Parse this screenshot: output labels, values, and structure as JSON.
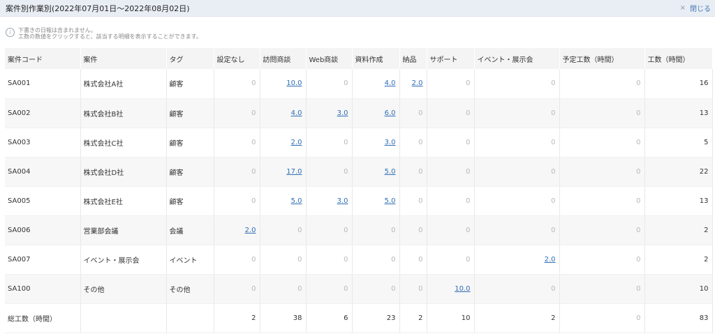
{
  "header": {
    "title": "案件別作業別(2022年07月01日〜2022年08月02日)",
    "close_x": "×",
    "close_label": "閉じる"
  },
  "notice": {
    "line1": "下書きの日報は含まれません。",
    "line2": "工数の数値をクリックすると、該当する明細を表示することができます。"
  },
  "table": {
    "headers": [
      "案件コード",
      "案件",
      "タグ",
      "設定なし",
      "訪問商談",
      "Web商談",
      "資料作成",
      "納品",
      "サポート",
      "イベント・展示会",
      "予定工数（時間）",
      "工数（時間）"
    ],
    "rows": [
      {
        "code": "SA001",
        "name": "株式会社A社",
        "tag": "顧客",
        "values": [
          "0",
          "10.0",
          "0",
          "4.0",
          "2.0",
          "0",
          "0",
          "0",
          "16"
        ]
      },
      {
        "code": "SA002",
        "name": "株式会社B社",
        "tag": "顧客",
        "values": [
          "0",
          "4.0",
          "3.0",
          "6.0",
          "0",
          "0",
          "0",
          "0",
          "13"
        ]
      },
      {
        "code": "SA003",
        "name": "株式会社C社",
        "tag": "顧客",
        "values": [
          "0",
          "2.0",
          "0",
          "3.0",
          "0",
          "0",
          "0",
          "0",
          "5"
        ]
      },
      {
        "code": "SA004",
        "name": "株式会社D社",
        "tag": "顧客",
        "values": [
          "0",
          "17.0",
          "0",
          "5.0",
          "0",
          "0",
          "0",
          "0",
          "22"
        ]
      },
      {
        "code": "SA005",
        "name": "株式会社E社",
        "tag": "顧客",
        "values": [
          "0",
          "5.0",
          "3.0",
          "5.0",
          "0",
          "0",
          "0",
          "0",
          "13"
        ]
      },
      {
        "code": "SA006",
        "name": "営業部会議",
        "tag": "会議",
        "values": [
          "2.0",
          "0",
          "0",
          "0",
          "0",
          "0",
          "0",
          "0",
          "2"
        ]
      },
      {
        "code": "SA007",
        "name": "イベント・展示会",
        "tag": "イベント",
        "values": [
          "0",
          "0",
          "0",
          "0",
          "0",
          "0",
          "2.0",
          "0",
          "2"
        ]
      },
      {
        "code": "SA100",
        "name": "その他",
        "tag": "その他",
        "values": [
          "0",
          "0",
          "0",
          "0",
          "0",
          "10.0",
          "0",
          "0",
          "10"
        ]
      }
    ],
    "total": {
      "label": "総工数（時間）",
      "values": [
        "2",
        "38",
        "6",
        "23",
        "2",
        "10",
        "2",
        "0",
        "83"
      ]
    }
  }
}
